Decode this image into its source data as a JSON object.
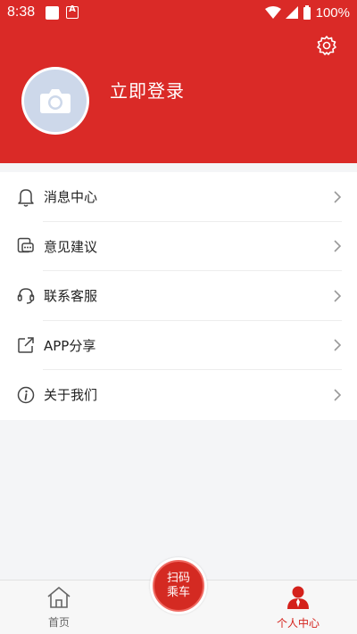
{
  "status_bar": {
    "time": "8:38",
    "battery": "100%"
  },
  "profile": {
    "login_label": "立即登录"
  },
  "menu": {
    "items": [
      {
        "label": "消息中心",
        "icon": "bell-icon"
      },
      {
        "label": "意见建议",
        "icon": "feedback-icon"
      },
      {
        "label": "联系客服",
        "icon": "headset-icon"
      },
      {
        "label": "APP分享",
        "icon": "share-icon"
      },
      {
        "label": "关于我们",
        "icon": "info-icon"
      }
    ]
  },
  "scan_button": {
    "line1": "扫码",
    "line2": "乘车"
  },
  "tabbar": {
    "home_label": "首页",
    "me_label": "个人中心"
  },
  "colors": {
    "brand_red": "#da2a27",
    "active_tab": "#d4211b"
  }
}
